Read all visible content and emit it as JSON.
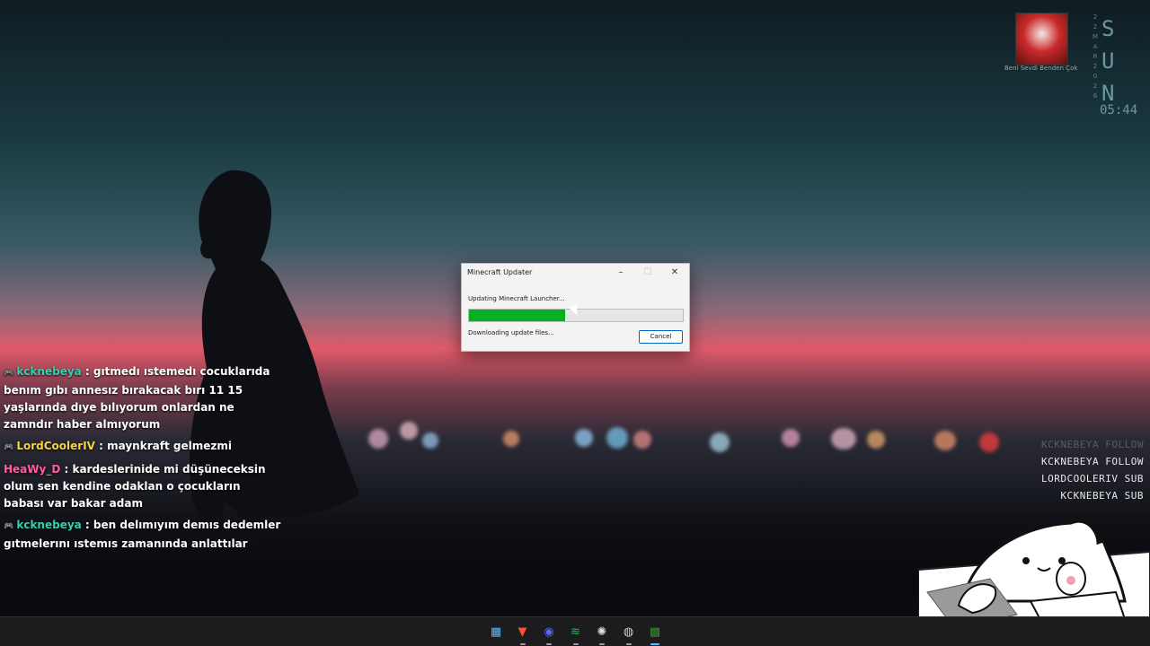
{
  "dialog": {
    "title": "Minecraft Updater",
    "minimize": "–",
    "maximize": "☐",
    "close": "✕",
    "status": "Updating Minecraft Launcher...",
    "progress_percent": 45,
    "detail": "Downloading update files...",
    "cancel_label": "Cancel"
  },
  "chat": [
    {
      "user": "kcknebeya",
      "user_color": "#33d1b0",
      "text": " : gıtmedı ıstemedı cocuklarıda benım gıbı annesız bırakacak bırı 11 15 yaşlarında dıye bılıyorum onlardan ne zamndır haber almıyorum"
    },
    {
      "user": "LordCoolerIV",
      "user_color": "#f5d342",
      "text": " : maynkraft gelmezmi"
    },
    {
      "user": "HeaWy_D",
      "user_color": "#ff5fa0",
      "text": " : kardeslerinide mi düşüneceksin olum sen kendine odaklan o çocukların babası var bakar adam"
    },
    {
      "user": "kcknebeya",
      "user_color": "#33d1b0",
      "text": " : ben delımıyım demıs dedemler gıtmelerını ıstemıs zamanında anlattılar"
    }
  ],
  "events": [
    {
      "text": "KCKNEBEYA FOLLOW",
      "faded": true
    },
    {
      "text": "KCKNEBEYA FOLLOW",
      "faded": false
    },
    {
      "text": "LORDCOOLERIV SUB",
      "faded": false
    },
    {
      "text": "KCKNEBEYA SUB",
      "faded": false
    }
  ],
  "widget": {
    "song": "Beni Sevdi Benden Çok",
    "date": [
      "2",
      "2",
      "M",
      "A",
      "R",
      "2",
      "0",
      "2",
      "6"
    ],
    "day": [
      "S",
      "U",
      "N"
    ],
    "time": "05:44"
  },
  "taskbar": [
    {
      "name": "windows-start-icon",
      "glyph": "▦",
      "color": "#4cc2ff"
    },
    {
      "name": "brave-icon",
      "glyph": "▼",
      "color": "#fb542b"
    },
    {
      "name": "discord-icon",
      "glyph": "◉",
      "color": "#5865f2"
    },
    {
      "name": "spotify-icon",
      "glyph": "≋",
      "color": "#1db954"
    },
    {
      "name": "steam-icon",
      "glyph": "✺",
      "color": "#e0e0e0"
    },
    {
      "name": "obs-icon",
      "glyph": "◍",
      "color": "#d0d0d0"
    },
    {
      "name": "minecraft-icon",
      "glyph": "▩",
      "color": "#3c8a2a"
    }
  ]
}
